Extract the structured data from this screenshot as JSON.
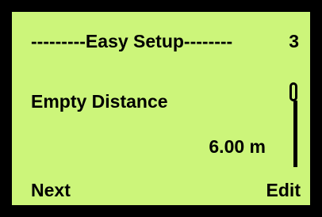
{
  "screen": {
    "title": "---------Easy Setup--------",
    "page_number": "3",
    "parameter_label": "Empty Distance",
    "parameter_value": "6.00 m",
    "softkeys": {
      "left": "Next",
      "right": "Edit"
    },
    "scroll_position": 0
  },
  "colors": {
    "lcd_background": "#ccf57a",
    "text": "#000000",
    "frame": "#000000"
  }
}
